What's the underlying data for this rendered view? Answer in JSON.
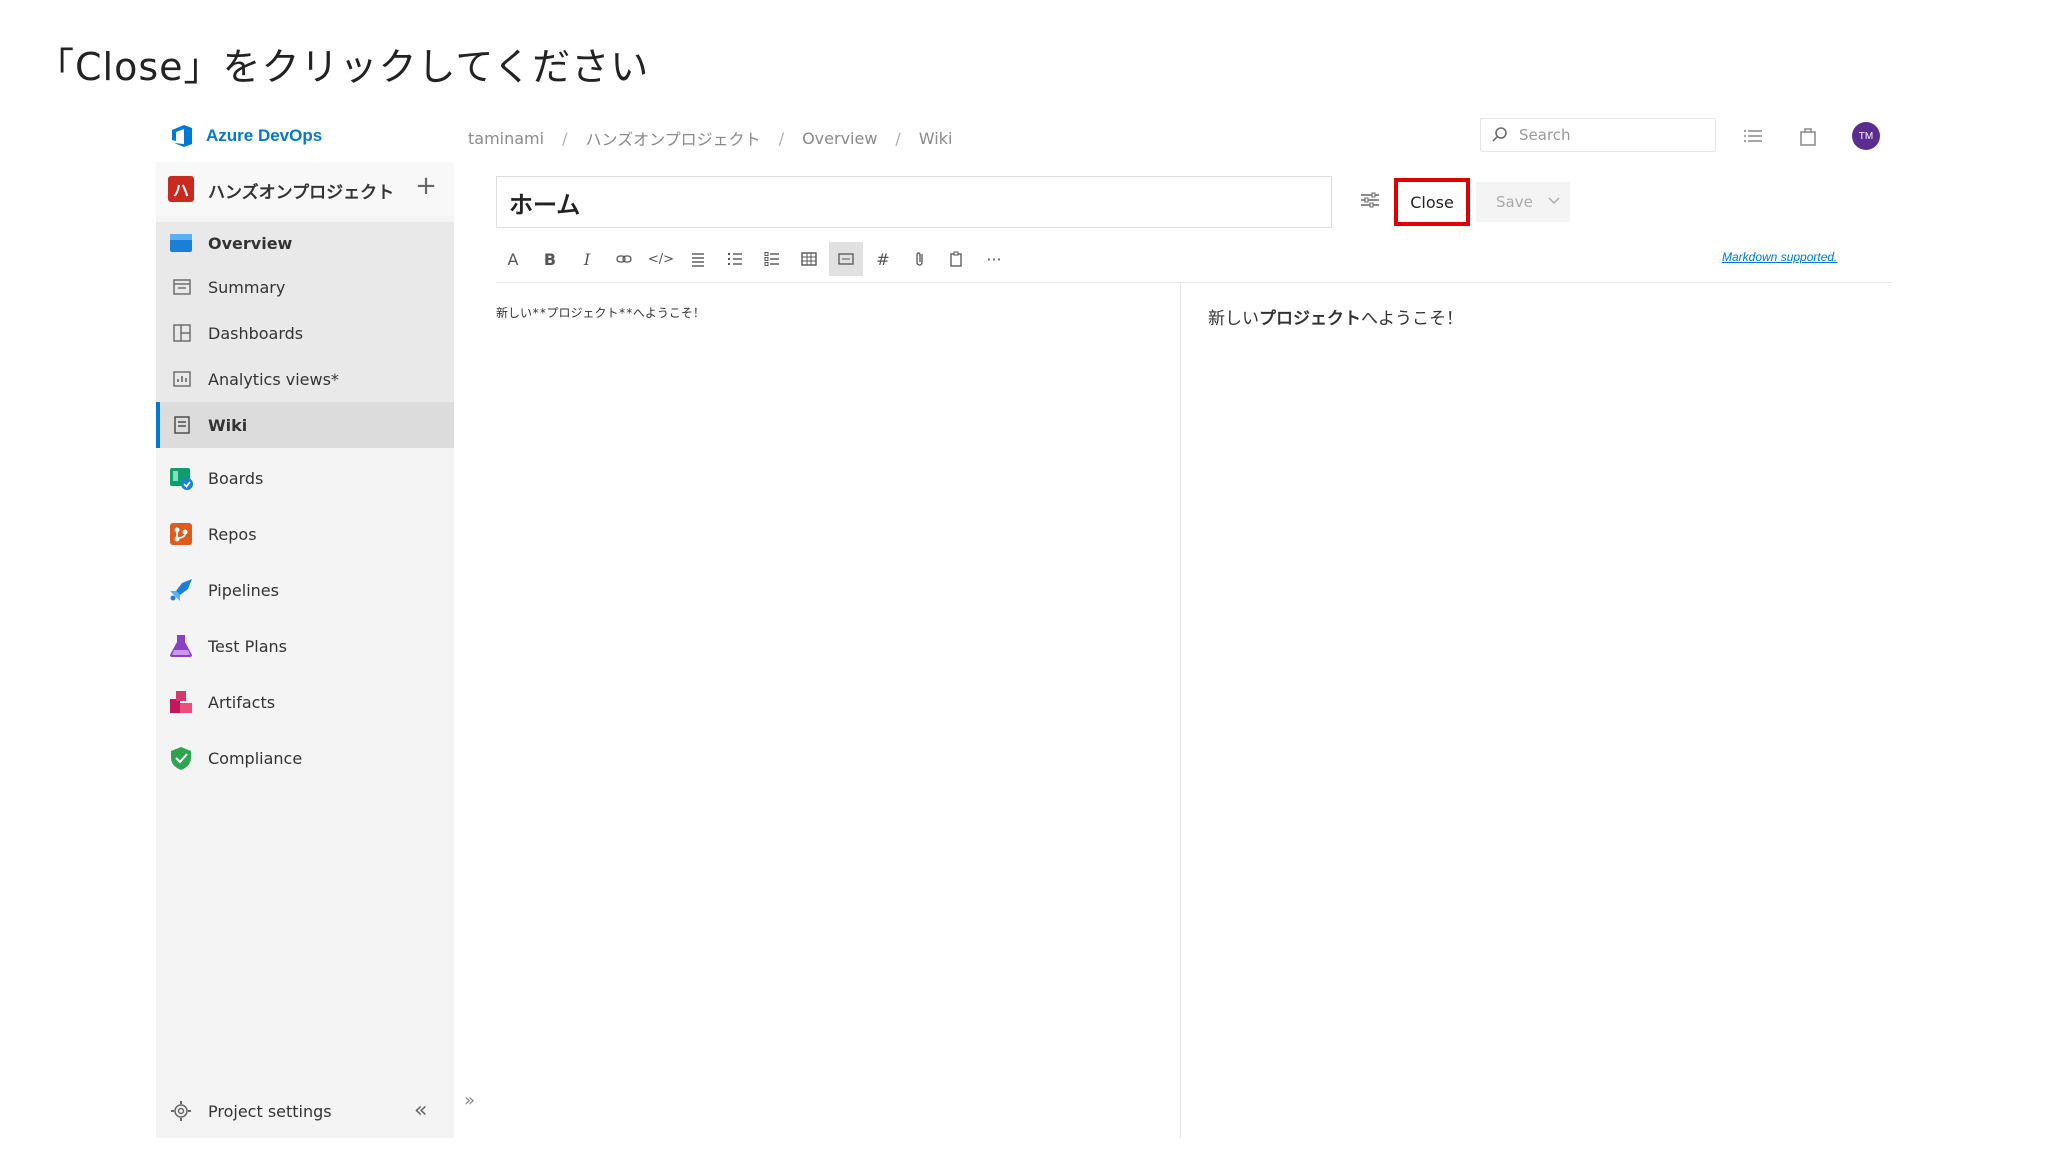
{
  "instruction": "「Close」をクリックしてください",
  "topbar": {
    "brand": "Azure DevOps",
    "breadcrumbs": [
      "taminami",
      "ハンズオンプロジェクト",
      "Overview",
      "Wiki"
    ],
    "search_placeholder": "Search",
    "avatar_initials": "TM"
  },
  "sidebar": {
    "project_initial": "ハ",
    "project_name": "ハンズオンプロジェクト",
    "items": [
      {
        "label": "Overview",
        "icon": "overview-icon"
      },
      {
        "label": "Summary",
        "icon": "summary-icon"
      },
      {
        "label": "Dashboards",
        "icon": "dashboards-icon"
      },
      {
        "label": "Analytics views*",
        "icon": "analytics-icon"
      },
      {
        "label": "Wiki",
        "icon": "wiki-icon"
      },
      {
        "label": "Boards",
        "icon": "boards-icon"
      },
      {
        "label": "Repos",
        "icon": "repos-icon"
      },
      {
        "label": "Pipelines",
        "icon": "pipelines-icon"
      },
      {
        "label": "Test Plans",
        "icon": "test-plans-icon"
      },
      {
        "label": "Artifacts",
        "icon": "artifacts-icon"
      },
      {
        "label": "Compliance",
        "icon": "compliance-icon"
      }
    ],
    "settings_label": "Project settings"
  },
  "editor": {
    "title_value": "ホーム",
    "close_label": "Close",
    "save_label": "Save",
    "markdown_link": "Markdown supported.",
    "source_text": "新しい**プロジェクト**へようこそ！",
    "preview_before": "新しい",
    "preview_bold": "プロジェクト",
    "preview_after": "へようこそ！"
  },
  "colors": {
    "accent": "#0078d4",
    "highlight_box": "#e10000",
    "avatar": "#5c2d91"
  }
}
